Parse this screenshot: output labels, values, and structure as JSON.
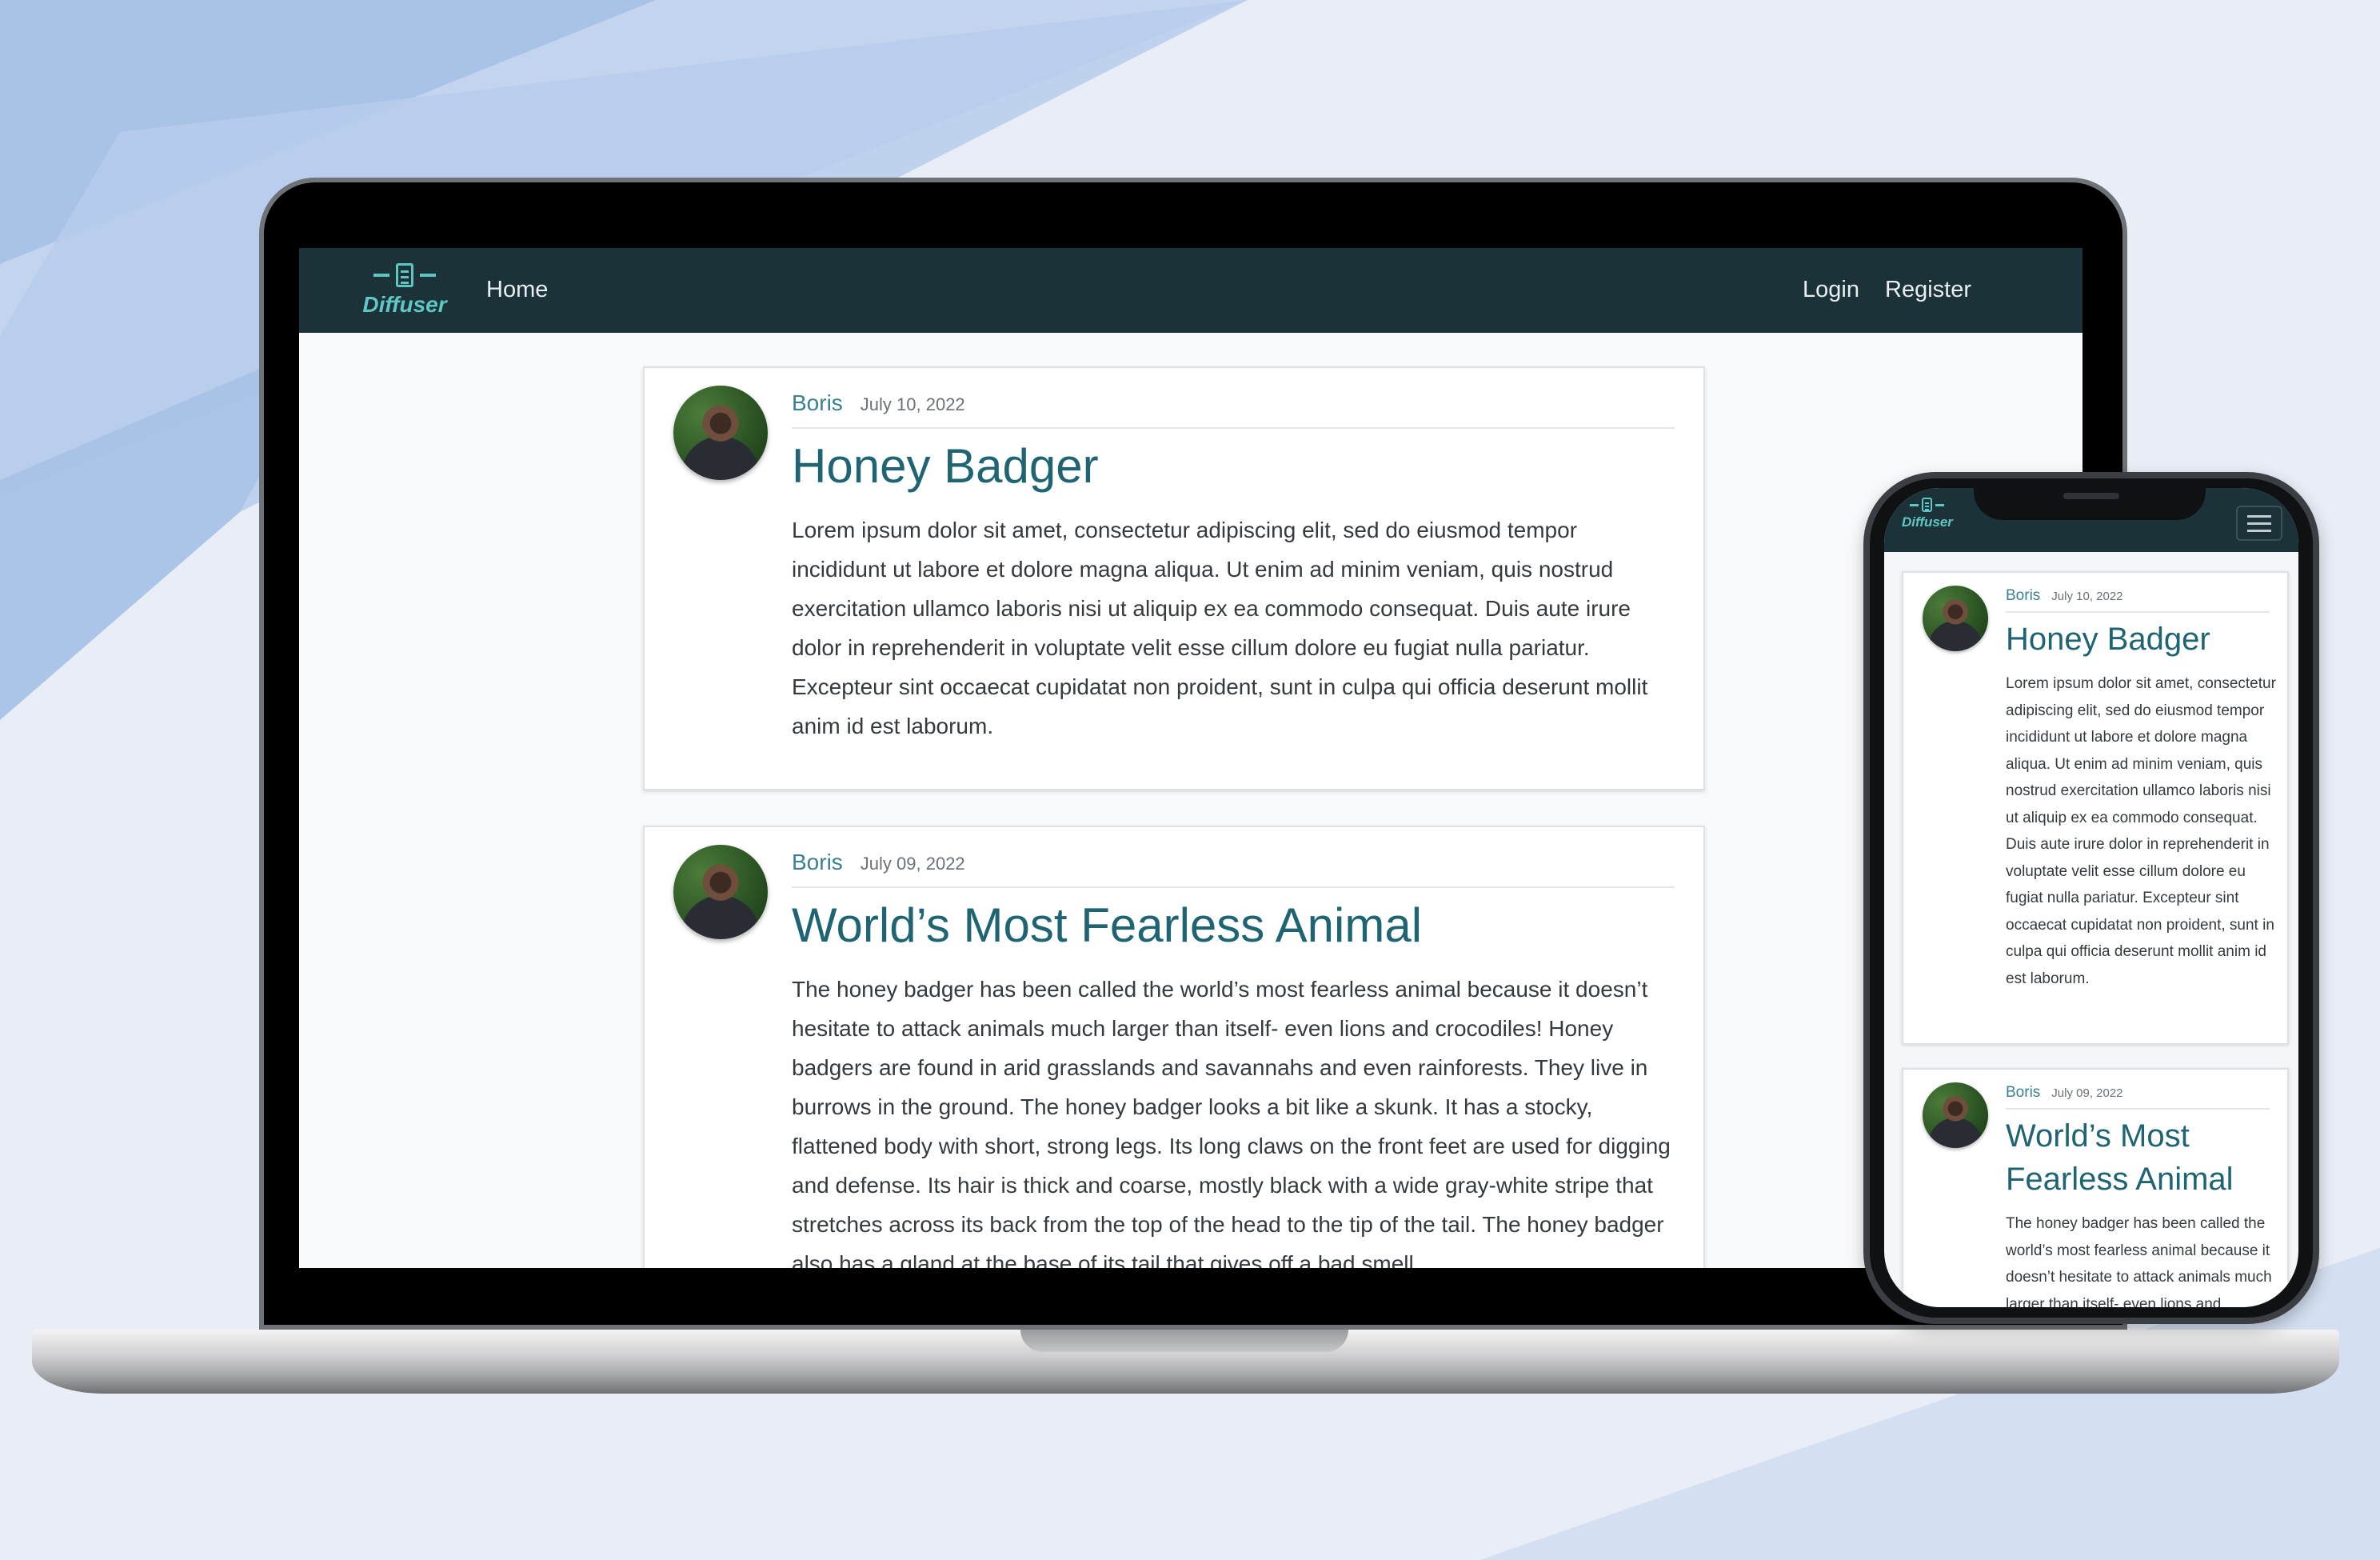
{
  "colors": {
    "navbar_bg": "#1b3238",
    "brand_accent": "#5fc6c4",
    "title_color": "#1f6473",
    "author_color": "#3a8090",
    "page_bg": "#f9fafc"
  },
  "site": {
    "brand": "Diffuser",
    "brand_icon": "clipboard-icon",
    "nav": {
      "home": "Home",
      "login": "Login",
      "register": "Register"
    },
    "menu_icon": "hamburger-menu-icon"
  },
  "posts": [
    {
      "author": "Boris",
      "date": "July 10, 2022",
      "title": "Honey Badger",
      "body": "Lorem ipsum dolor sit amet, consectetur adipiscing elit, sed do eiusmod tempor incididunt ut labore et dolore magna aliqua. Ut enim ad minim veniam, quis nostrud exercitation ullamco laboris nisi ut aliquip ex ea commodo consequat. Duis aute irure dolor in reprehenderit in voluptate velit esse cillum dolore eu fugiat nulla pariatur. Excepteur sint occaecat cupidatat non proident, sunt in culpa qui officia deserunt mollit anim id est laborum."
    },
    {
      "author": "Boris",
      "date": "July 09, 2022",
      "title": "World’s Most Fearless Animal",
      "body": "The honey badger has been called the world’s most fearless animal because it doesn’t hesitate to attack animals much larger than itself- even lions and crocodiles! Honey badgers are found in arid grasslands and savannahs and even rainforests. They live in burrows in the ground. The honey badger looks a bit like a skunk. It has a stocky, flattened body with short, strong legs. Its long claws on the front feet are used for digging and defense. Its hair is thick and coarse, mostly black with a wide gray-white stripe that stretches across its back from the top of the head to the tip of the tail. The honey badger also has a gland at the base of its tail that gives off a bad smell."
    }
  ]
}
